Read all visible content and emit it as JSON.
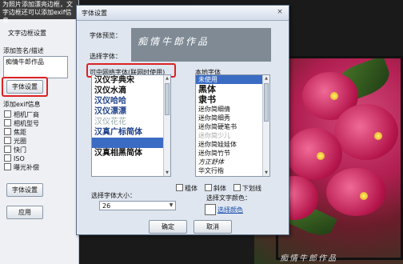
{
  "left_panel": {
    "hint_text": "为照片添加漂亮边框，文字边框还可以添加exif信息",
    "section_title": "文字边框设置",
    "sign_label": "添加签名/描述",
    "sign_value": "痴情牛郎作品",
    "font_settings_button": "字体设置",
    "exif_label": "添加exif信息",
    "exif_items": [
      "相机厂商",
      "相机型号",
      "焦距",
      "光圈",
      "快门",
      "ISO",
      "曝光补偿"
    ],
    "font_settings_button2": "字体设置",
    "apply_button": "应用"
  },
  "dialog": {
    "title": "字体设置",
    "close_label": "×",
    "preview_label": "字体预览：",
    "preview_text": "痴情牛郎作品",
    "select_label": "选择字体：",
    "available_fonts_label": "可中网络字体(联网时使用)",
    "available_fonts": [
      "汉仪字典宋",
      "汉仪水滴",
      "汉仪哈哈",
      "汉仪漂漂",
      "汉仪花花",
      "汉真广标简体",
      "",
      "汉真相黑简体"
    ],
    "local_fonts_label": "本地字体",
    "local_fonts": [
      "未使用",
      "黑体",
      "隶书",
      "迷你简细倩",
      "迷你简细秀",
      "迷你简硬笔书",
      "迷你简少儿",
      "迷你简娃娃体",
      "迷你简竹节",
      "方正舒体",
      "华文行楷"
    ],
    "size_label": "选择字体大小：",
    "size_value": "26",
    "bold_label": "粗体",
    "italic_label": "斜体",
    "underline_label": "下划线",
    "color_label": "选择文字颜色：",
    "color_link": "选择颜色",
    "ok_button": "确定",
    "cancel_button": "取消"
  },
  "photo": {
    "signature": "痴情牛郎作品"
  }
}
